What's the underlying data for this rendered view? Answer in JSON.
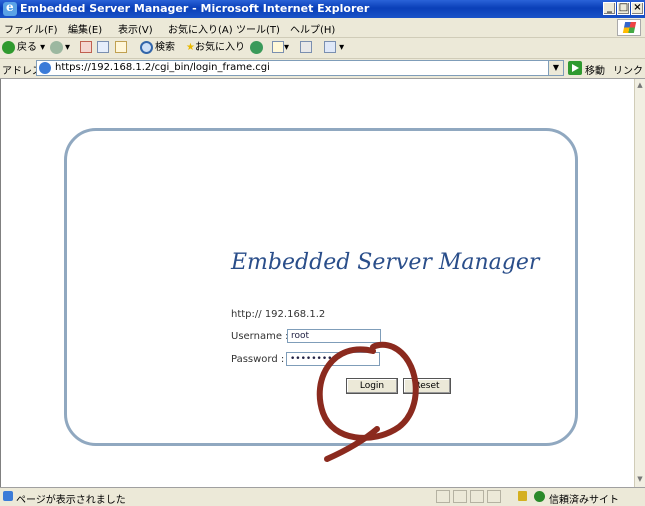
{
  "window": {
    "title": "Embedded Server Manager - Microsoft Internet Explorer",
    "minimize": "_",
    "maximize": "□",
    "close": "×"
  },
  "menu": {
    "items": [
      "ファイル(F)",
      "編集(E)",
      "表示(V)",
      "お気に入り(A)",
      "ツール(T)",
      "ヘルプ(H)"
    ]
  },
  "toolbar": {
    "back": "戻る",
    "search": "検索",
    "favorites": "お気に入り"
  },
  "address": {
    "label": "アドレス(D)",
    "url": "https://192.168.1.2/cgi_bin/login_frame.cgi",
    "go_label": "移動",
    "links_label": "リンク »"
  },
  "login": {
    "product_title": "Embedded Server Manager",
    "server_address": "http:// 192.168.1.2",
    "username_label": "Username :",
    "username_value": "root",
    "password_label": "Password :",
    "password_value": "••••••••",
    "login_button": "Login",
    "reset_button": "Reset"
  },
  "status": {
    "text": "ページが表示されました",
    "zone": "信頼済みサイト"
  },
  "colors": {
    "titlebar": "#0a3fb8",
    "panel_border": "#90a8c0",
    "product_title": "#2a4e8a",
    "annotation": "#8b2a1e"
  },
  "icons": [
    "ie-icon",
    "back-icon",
    "forward-icon",
    "stop-icon",
    "refresh-icon",
    "home-icon",
    "search-icon",
    "favorites-icon",
    "history-icon",
    "mail-icon",
    "print-icon",
    "word-icon",
    "go-icon",
    "lock-icon",
    "trusted-zone-icon"
  ]
}
